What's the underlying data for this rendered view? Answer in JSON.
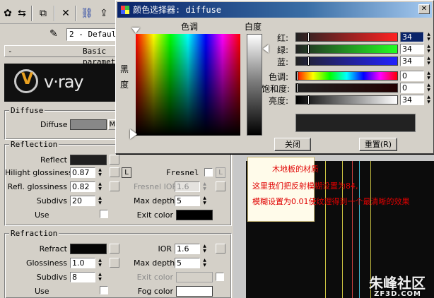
{
  "editor": {
    "slot_name": "2 - Default",
    "rollout_title": "Basic parameters",
    "diffuse": {
      "group": "Diffuse",
      "label": "Diffuse",
      "map_button": "M"
    },
    "reflection": {
      "group": "Reflection",
      "reflect_label": "Reflect",
      "hilight_label": "Hilight glossiness",
      "hilight_value": "0.87",
      "hilight_lock": "L",
      "fresnel_label": "Fresnel",
      "fresnel_lock": "L",
      "refl_label": "Refl. glossiness",
      "refl_value": "0.82",
      "fresnel_ior_label": "Fresnel IOR",
      "fresnel_ior_value": "1.6",
      "subdivs_label": "Subdivs",
      "subdivs_value": "20",
      "max_depth_label": "Max depth",
      "max_depth_value": "5",
      "use_label": "Use",
      "exit_color_label": "Exit color"
    },
    "refraction": {
      "group": "Refraction",
      "refract_label": "Refract",
      "ior_label": "IOR",
      "ior_value": "1.6",
      "glossiness_label": "Glossiness",
      "glossiness_value": "1.0",
      "max_depth_label": "Max depth",
      "max_depth_value": "5",
      "subdivs_label": "Subdivs",
      "subdivs_value": "8",
      "exit_color_label": "Exit color",
      "use_label": "Use",
      "fog_color_label": "Fog color"
    }
  },
  "picker": {
    "title": "颜色选择器: diffuse",
    "hue_label": "色调",
    "whiteness_label": "白度",
    "blackness_label": "黑度",
    "channels": [
      {
        "label": "红:",
        "value": "34"
      },
      {
        "label": "绿:",
        "value": "34"
      },
      {
        "label": "蓝:",
        "value": "34"
      },
      {
        "label": "色调:",
        "value": "0"
      },
      {
        "label": "饱和度:",
        "value": "0"
      },
      {
        "label": "亮度:",
        "value": "34"
      }
    ],
    "close_button": "关闭",
    "reset_button": "重置(R)",
    "preview_color": "#222222"
  },
  "annotations": {
    "line1": "木地板的材质",
    "line2": "这里我们把反射模糊设置为84,",
    "line3": "模糊设置为0.01使纹理得到一个最清晰的效果"
  },
  "watermark": {
    "main": "朱峰社区",
    "sub": "ZF3D.COM"
  },
  "colors": {
    "reflect_swatch": "#202020",
    "exit_color": "#000000",
    "refract_swatch": "#050505",
    "fog_color": "#ffffff",
    "diffuse_swatch": "#888888"
  }
}
